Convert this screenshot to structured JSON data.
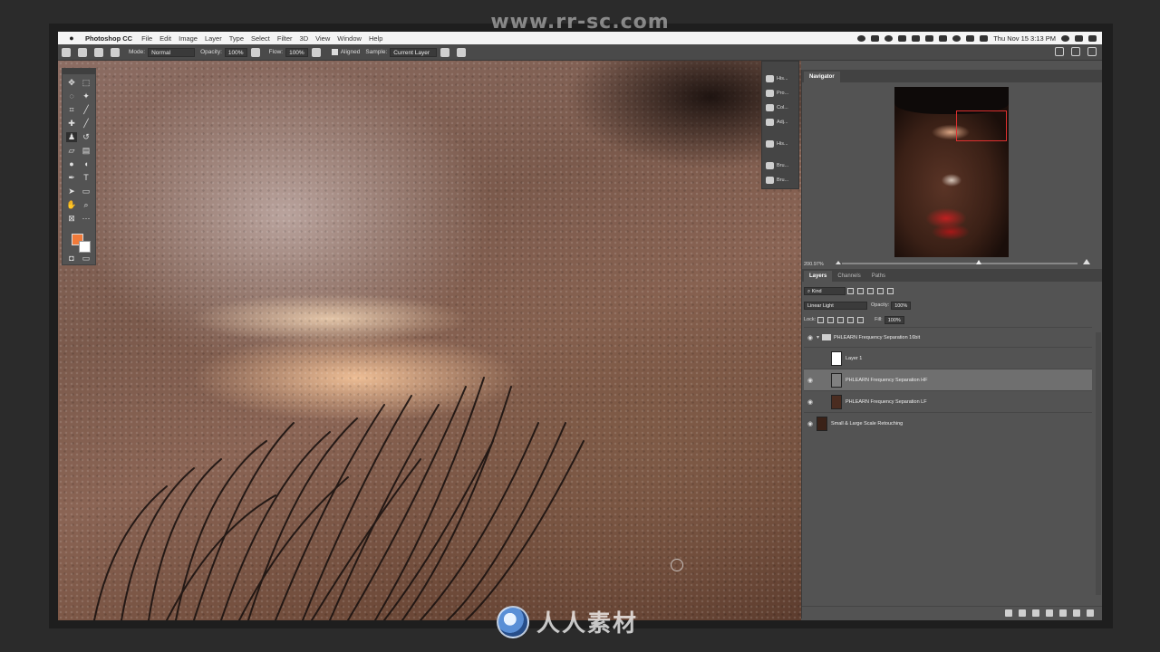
{
  "watermark_top": "www.rr-sc.com",
  "watermark_bottom": "人人素材",
  "menubar": {
    "app_name": "Photoshop CC",
    "items": [
      "File",
      "Edit",
      "Image",
      "Layer",
      "Type",
      "Select",
      "Filter",
      "3D",
      "View",
      "Window",
      "Help"
    ],
    "datetime": "Thu Nov 15  3:13 PM"
  },
  "options": {
    "mode_label": "Mode:",
    "mode_value": "Normal",
    "opacity_label": "Opacity:",
    "opacity_value": "100%",
    "flow_label": "Flow:",
    "flow_value": "100%",
    "aligned_label": "Aligned",
    "sample_label": "Sample:",
    "sample_value": "Current Layer"
  },
  "strip": [
    "His...",
    "Pro...",
    "Col...",
    "Adj...",
    "His...",
    "Bru...",
    "Bru..."
  ],
  "navigator": {
    "tab": "Navigator",
    "zoom": "200.97%",
    "zoom_fraction": 0.58
  },
  "layers": {
    "tabs": [
      "Layers",
      "Channels",
      "Paths"
    ],
    "kind_label": "Kind",
    "blend_mode": "Linear Light",
    "opacity_label": "Opacity:",
    "opacity_value": "100%",
    "lock_label": "Lock:",
    "fill_label": "Fill:",
    "fill_value": "100%",
    "items": [
      {
        "name": "PHLEARN Frequency Separation 16bit",
        "type": "group"
      },
      {
        "name": "Layer 1",
        "type": "layer"
      },
      {
        "name": "PHLEARN Frequency Separation HF",
        "type": "layer",
        "selected": true
      },
      {
        "name": "PHLEARN Frequency Separation LF",
        "type": "layer"
      },
      {
        "name": "Small & Large Scale Retouching",
        "type": "layer"
      }
    ]
  },
  "colors": {
    "foreground": "#f07a3a",
    "background": "#ffffff"
  }
}
